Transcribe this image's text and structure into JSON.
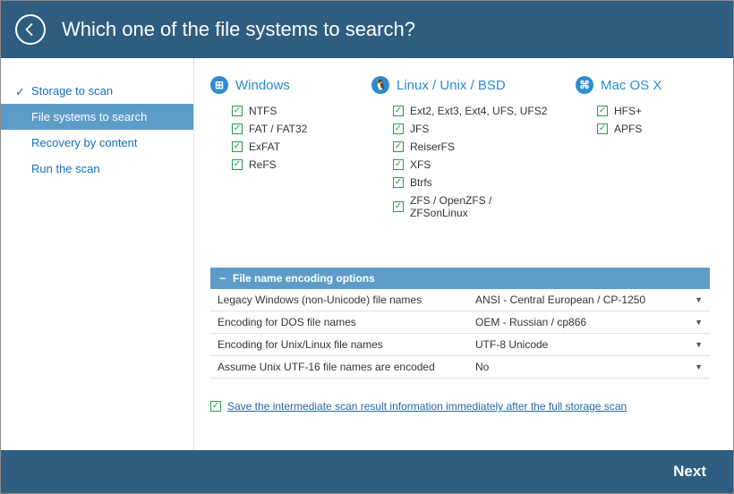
{
  "header": {
    "title": "Which one of the file systems to search?"
  },
  "sidebar": {
    "steps": [
      {
        "label": "Storage to scan",
        "done": true
      },
      {
        "label": "File systems to search",
        "active": true
      },
      {
        "label": "Recovery by content"
      },
      {
        "label": "Run the scan"
      }
    ]
  },
  "columns": [
    {
      "name": "Windows",
      "icon": "⊞",
      "items": [
        "NTFS",
        "FAT / FAT32",
        "ExFAT",
        "ReFS"
      ]
    },
    {
      "name": "Linux / Unix / BSD",
      "icon": "🐧",
      "items": [
        "Ext2, Ext3, Ext4, UFS, UFS2",
        "JFS",
        "ReiserFS",
        "XFS",
        "Btrfs",
        "ZFS / OpenZFS / ZFSonLinux"
      ]
    },
    {
      "name": "Mac OS X",
      "icon": "⌘",
      "items": [
        "HFS+",
        "APFS"
      ]
    }
  ],
  "encoding": {
    "header": "File name encoding options",
    "rows": [
      {
        "label": "Legacy Windows (non-Unicode) file names",
        "value": "ANSI - Central European / CP-1250"
      },
      {
        "label": "Encoding for DOS file names",
        "value": "OEM - Russian / cp866"
      },
      {
        "label": "Encoding for Unix/Linux file names",
        "value": "UTF-8 Unicode"
      },
      {
        "label": "Assume Unix UTF-16 file names are encoded",
        "value": "No"
      }
    ]
  },
  "save_option": "Save the intermediate scan result information immediately after the full storage scan",
  "footer": {
    "next": "Next"
  }
}
